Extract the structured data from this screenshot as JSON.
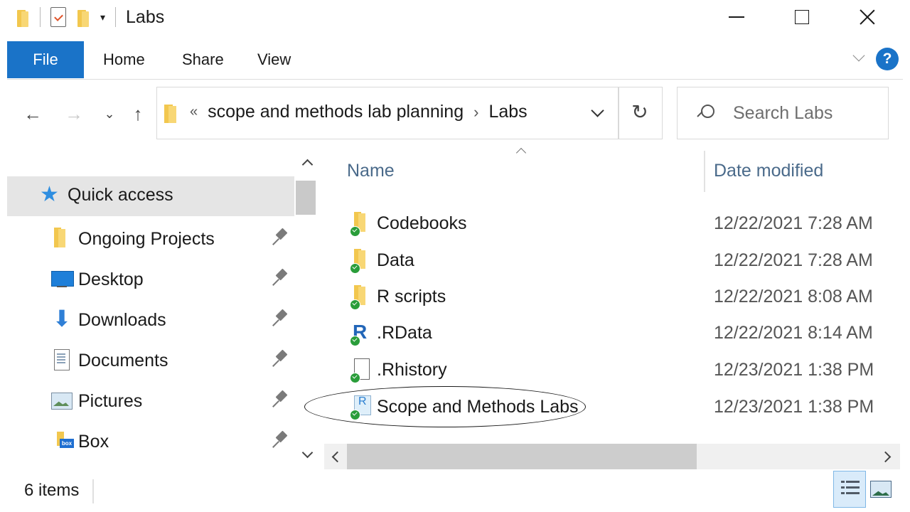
{
  "window": {
    "title": "Labs",
    "controls": {
      "minimize": "minimize",
      "maximize": "maximize",
      "close": "close"
    }
  },
  "ribbon": {
    "tabs": [
      {
        "label": "File",
        "active": true
      },
      {
        "label": "Home"
      },
      {
        "label": "Share"
      },
      {
        "label": "View"
      }
    ],
    "help_label": "?"
  },
  "nav": {
    "back": "←",
    "forward": "→",
    "recent": "⌄",
    "up": "↑",
    "overflow": "«",
    "breadcrumb": [
      "scope and methods lab planning",
      "Labs"
    ],
    "separator": "›",
    "refresh": "↻"
  },
  "search": {
    "placeholder": "Search Labs"
  },
  "sidebar": {
    "quick_access": "Quick access",
    "items": [
      {
        "label": "Ongoing Projects",
        "icon": "folder-icon",
        "pinned": true
      },
      {
        "label": "Desktop",
        "icon": "desktop-icon",
        "pinned": true
      },
      {
        "label": "Downloads",
        "icon": "download-icon",
        "pinned": true
      },
      {
        "label": "Documents",
        "icon": "documents-icon",
        "pinned": true
      },
      {
        "label": "Pictures",
        "icon": "pictures-icon",
        "pinned": true
      },
      {
        "label": "Box",
        "icon": "box-icon",
        "pinned": true
      }
    ]
  },
  "file_list": {
    "columns": {
      "name": "Name",
      "date": "Date modified"
    },
    "files": [
      {
        "name": "Codebooks",
        "date": "12/22/2021 7:28 AM",
        "icon": "folder-icon",
        "synced": true
      },
      {
        "name": "Data",
        "date": "12/22/2021 7:28 AM",
        "icon": "folder-icon",
        "synced": true
      },
      {
        "name": "R scripts",
        "date": "12/22/2021 8:08 AM",
        "icon": "folder-icon",
        "synced": true
      },
      {
        "name": ".RData",
        "date": "12/22/2021 8:14 AM",
        "icon": "r-data-icon",
        "synced": true
      },
      {
        "name": ".Rhistory",
        "date": "12/23/2021 1:38 PM",
        "icon": "file-icon",
        "synced": true
      },
      {
        "name": "Scope and Methods Labs",
        "date": "12/23/2021 1:38 PM",
        "icon": "r-project-icon",
        "synced": true,
        "highlighted": true
      }
    ]
  },
  "status": {
    "item_count": "6 items"
  },
  "colors": {
    "accent": "#1a73c8",
    "header_text": "#4a6a8a",
    "selected_bg": "#e5e5e5",
    "sync_green": "#2a9d3a"
  }
}
